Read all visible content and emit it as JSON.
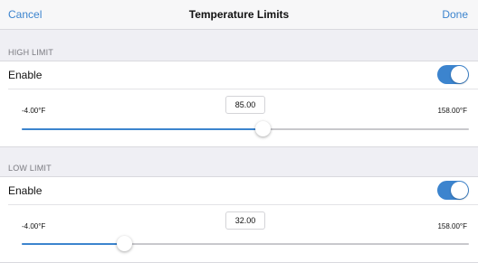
{
  "navbar": {
    "cancel_label": "Cancel",
    "title": "Temperature Limits",
    "done_label": "Done"
  },
  "high_limit": {
    "header": "HIGH LIMIT",
    "enable_label": "Enable",
    "enabled": true,
    "min_label": "-4.00°F",
    "max_label": "158.00°F",
    "value": "85.00",
    "slider_fraction": 0.54
  },
  "low_limit": {
    "header": "LOW LIMIT",
    "enable_label": "Enable",
    "enabled": true,
    "min_label": "-4.00°F",
    "max_label": "158.00°F",
    "value": "32.00",
    "slider_fraction": 0.23
  },
  "colors": {
    "accent": "#3c84ce",
    "background": "#efeff4"
  }
}
